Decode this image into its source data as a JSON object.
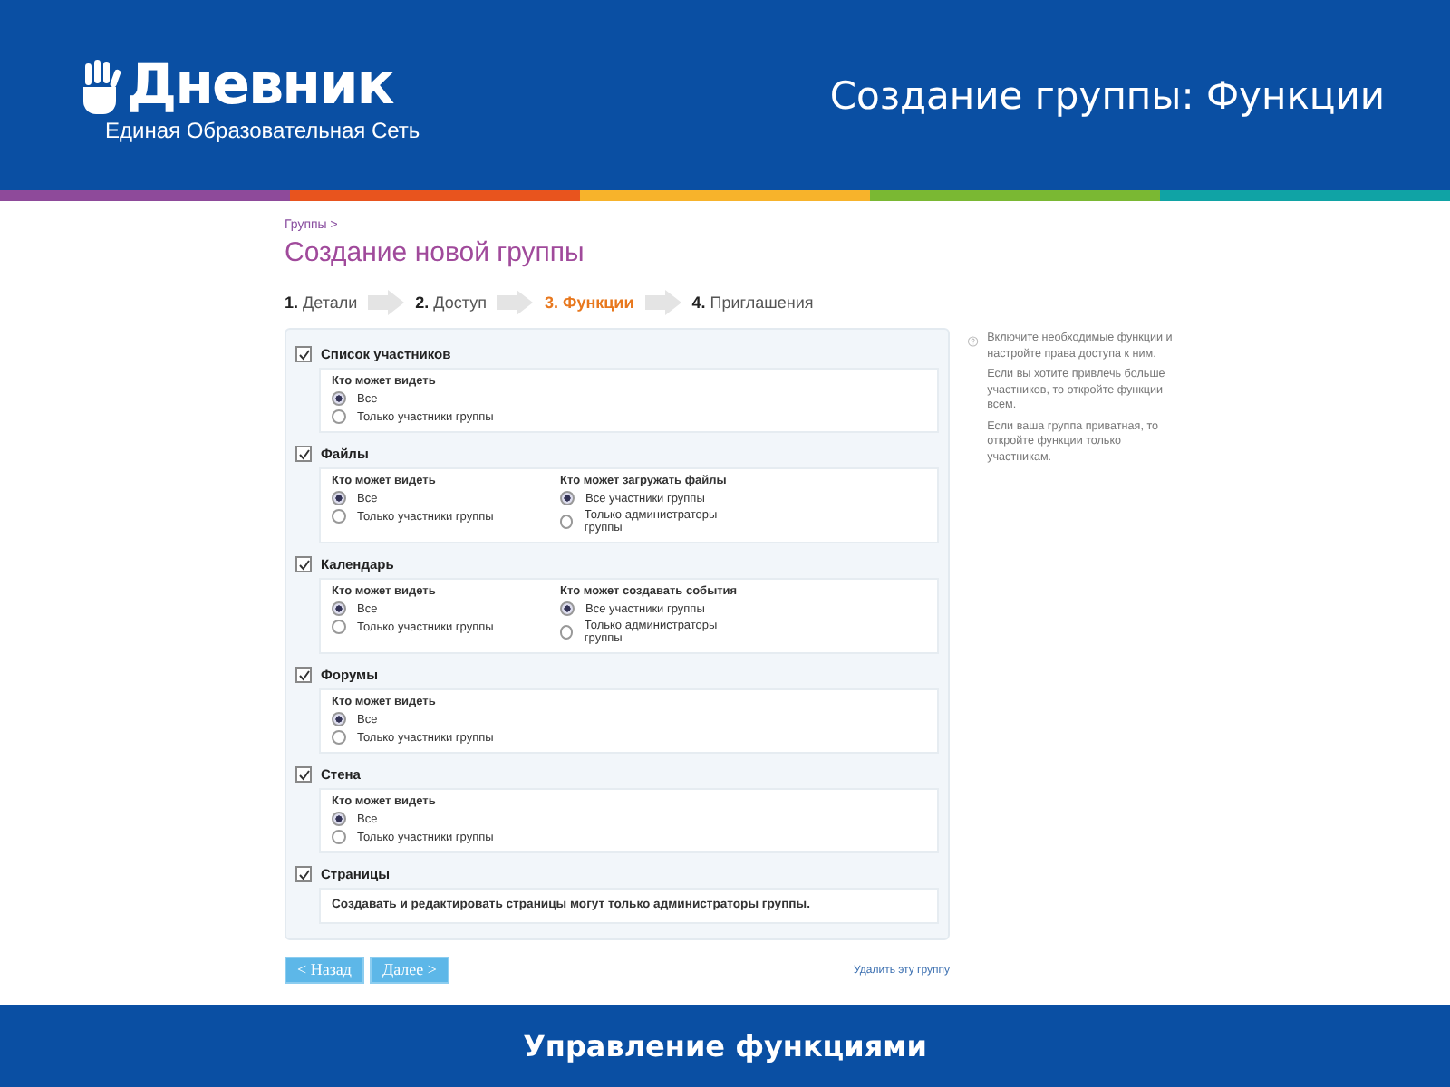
{
  "header": {
    "logo_text": "Дневник",
    "logo_subtitle": "Единая Образовательная Сеть",
    "title": "Создание группы: Функции"
  },
  "stripe": [
    {
      "color": "#8e4a9a"
    },
    {
      "color": "#e8541e"
    },
    {
      "color": "#f7b32b"
    },
    {
      "color": "#7ab833"
    },
    {
      "color": "#10a3a5"
    }
  ],
  "breadcrumb": "Группы >",
  "page_title": "Создание новой группы",
  "steps": [
    {
      "number": "1.",
      "label": "Детали",
      "selected": false
    },
    {
      "number": "2.",
      "label": "Доступ",
      "selected": false
    },
    {
      "number": "3.",
      "label": "Функции",
      "selected": true
    },
    {
      "number": "4.",
      "label": "Приглашения",
      "selected": false
    }
  ],
  "sections": [
    {
      "title": "Список участников",
      "checked": true,
      "groups": [
        {
          "label": "Кто может видеть",
          "options": [
            {
              "label": "Все",
              "selected": true
            },
            {
              "label": "Только участники группы",
              "selected": false
            }
          ]
        }
      ]
    },
    {
      "title": "Файлы",
      "checked": true,
      "groups": [
        {
          "label": "Кто может видеть",
          "options": [
            {
              "label": "Все",
              "selected": true
            },
            {
              "label": "Только участники группы",
              "selected": false
            }
          ]
        },
        {
          "label": "Кто может загружать файлы",
          "options": [
            {
              "label": "Все участники группы",
              "selected": true
            },
            {
              "label": "Только администраторы группы",
              "selected": false
            }
          ]
        }
      ]
    },
    {
      "title": "Календарь",
      "checked": true,
      "groups": [
        {
          "label": "Кто может видеть",
          "options": [
            {
              "label": "Все",
              "selected": true
            },
            {
              "label": "Только участники группы",
              "selected": false
            }
          ]
        },
        {
          "label": "Кто может создавать события",
          "options": [
            {
              "label": "Все участники группы",
              "selected": true
            },
            {
              "label": "Только администраторы группы",
              "selected": false
            }
          ]
        }
      ]
    },
    {
      "title": "Форумы",
      "checked": true,
      "groups": [
        {
          "label": "Кто может видеть",
          "options": [
            {
              "label": "Все",
              "selected": true
            },
            {
              "label": "Только участники группы",
              "selected": false
            }
          ]
        }
      ]
    },
    {
      "title": "Стена",
      "checked": true,
      "groups": [
        {
          "label": "Кто может видеть",
          "options": [
            {
              "label": "Все",
              "selected": true
            },
            {
              "label": "Только участники группы",
              "selected": false
            }
          ]
        }
      ]
    },
    {
      "title": "Страницы",
      "checked": true,
      "note": "Создавать и редактировать страницы могут только администраторы группы."
    }
  ],
  "help": [
    "Включите необходимые функции и настройте права доступа к ним.",
    "Если вы хотите привлечь больше участников, то откройте функции всем.",
    "Если ваша группа приватная, то откройте функции только участникам."
  ],
  "buttons": {
    "back": "< Назад",
    "next": "Далее >",
    "delete": "Удалить эту группу"
  },
  "footer": "Управление функциями"
}
